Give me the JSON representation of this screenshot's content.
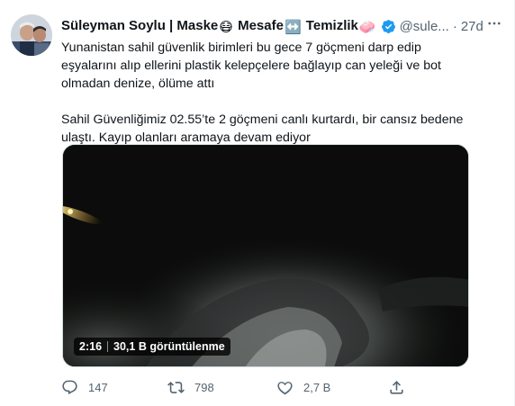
{
  "tweet": {
    "author_name": "Süleyman Soylu | Maske",
    "name_word_2": "Mesafe",
    "name_word_3": "Temizlik",
    "emoji_1": "😷",
    "emoji_2": "↔️",
    "emoji_3": "🧼",
    "handle": "@sule...",
    "time_separator": "·",
    "time": "27d",
    "paragraph_1": "Yunanistan sahil güvenlik birimleri bu gece 7 göçmeni darp edip eşyalarını alıp ellerini plastik kelepçelere bağlayıp can yeleği ve bot olmadan denize, ölüme attı",
    "paragraph_2": "Sahil Güvenliğimiz 02.55’te 2 göçmeni canlı kurtardı, bir cansız bedene ulaştı. Kayıp olanları aramaya devam ediyor"
  },
  "video": {
    "duration": "2:16",
    "views": "30,1 B görüntülenme"
  },
  "actions": {
    "replies": "147",
    "retweets": "798",
    "likes": "2,7 B"
  },
  "icons": {
    "verified": "verified-badge-icon",
    "more": "more-horizontal-icon",
    "reply": "reply-icon",
    "retweet": "retweet-icon",
    "like": "like-icon",
    "share": "share-icon"
  },
  "colors": {
    "verified": "#1d9bf0",
    "secondary_text": "#536471",
    "primary_text": "#0f1419"
  }
}
